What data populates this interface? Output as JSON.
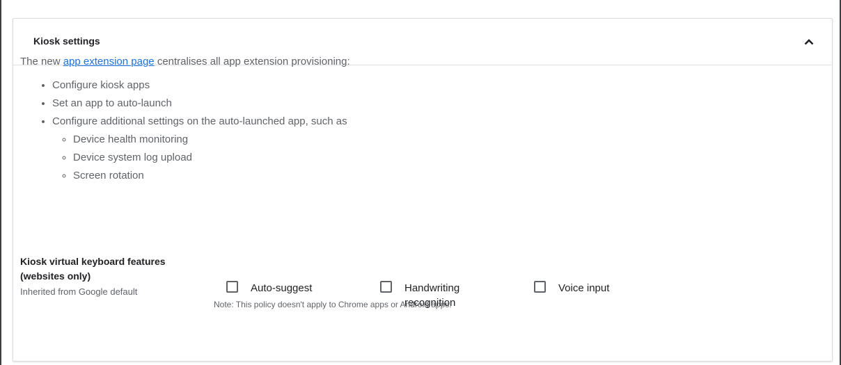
{
  "panel": {
    "title": "Kiosk settings"
  },
  "intro": {
    "prefix": "The new ",
    "link": "app extension page",
    "suffix": " centralises all app extension provisioning:"
  },
  "features": [
    "Configure kiosk apps",
    "Set an app to auto-launch",
    "Configure additional settings on the auto-launched app, such as"
  ],
  "sub_features": [
    "Device health monitoring",
    "Device system log upload",
    "Screen rotation"
  ],
  "setting": {
    "name": "Kiosk virtual keyboard features (websites only)",
    "inherited": "Inherited from Google default",
    "options": [
      {
        "label": "Auto-suggest",
        "checked": false
      },
      {
        "label": "Handwriting recognition",
        "checked": false
      },
      {
        "label": "Voice input",
        "checked": false
      }
    ],
    "note": "Note: This policy doesn't apply to Chrome apps or Android apps."
  },
  "icons": {
    "collapse": "chevron-up-icon"
  },
  "colors": {
    "link": "#1a73e8",
    "text_primary": "#202124",
    "text_secondary": "#5f6368",
    "border": "#dadce0"
  }
}
